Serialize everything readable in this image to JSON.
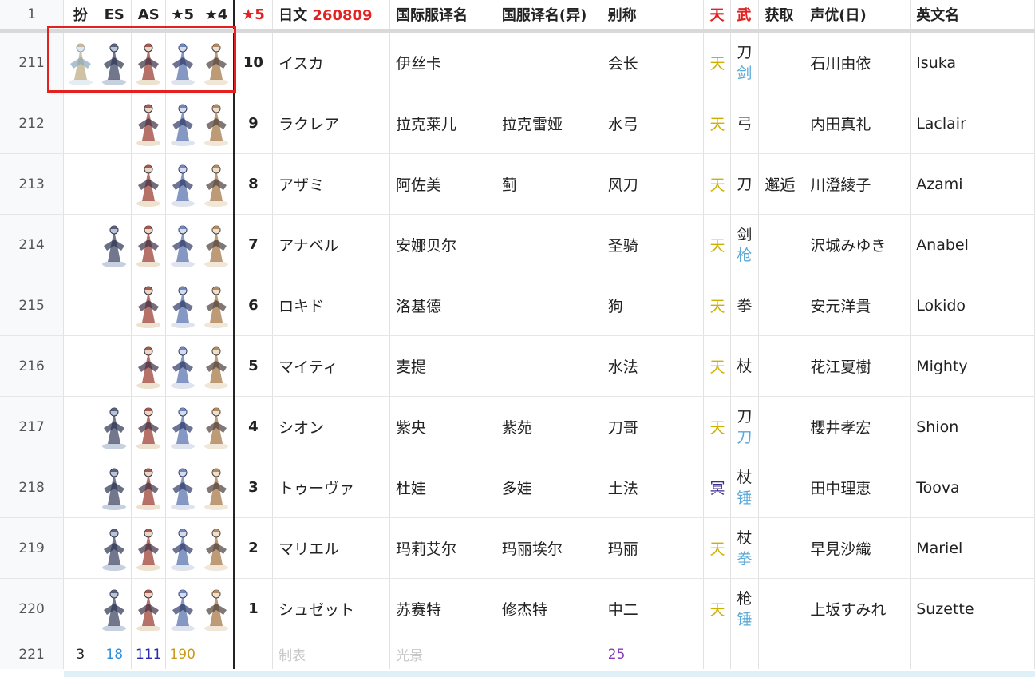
{
  "header": {
    "row_num": "1",
    "cols": [
      "扮",
      "ES",
      "AS",
      "★5",
      "★4",
      "★5",
      "日文",
      "260809",
      "国际服译名",
      "国服译名(异)",
      "别称",
      "天",
      "武",
      "获取",
      "声优(日)",
      "英文名"
    ]
  },
  "rows": [
    {
      "num": "211",
      "icons": [
        "costume",
        "es",
        "as",
        "s5",
        "s4"
      ],
      "rank": "10",
      "jp": "イスカ",
      "intl": "伊丝卡",
      "cn_alt": "",
      "alias": "会长",
      "tian": "天",
      "tian_type": "ten",
      "weapon": [
        "刀",
        "剑"
      ],
      "acquire": "",
      "cv": "石川由依",
      "en": "Isuka"
    },
    {
      "num": "212",
      "icons": [
        "",
        "",
        "as",
        "s5",
        "s4"
      ],
      "rank": "9",
      "jp": "ラクレア",
      "intl": "拉克莱儿",
      "cn_alt": "拉克雷娅",
      "alias": "水弓",
      "tian": "天",
      "tian_type": "ten",
      "weapon": [
        "弓"
      ],
      "acquire": "",
      "cv": "内田真礼",
      "en": "Laclair"
    },
    {
      "num": "213",
      "icons": [
        "",
        "",
        "as",
        "s5",
        "s4"
      ],
      "rank": "8",
      "jp": "アザミ",
      "intl": "阿佐美",
      "cn_alt": "蓟",
      "alias": "风刀",
      "tian": "天",
      "tian_type": "ten",
      "weapon": [
        "刀"
      ],
      "acquire": "邂逅",
      "cv": "川澄綾子",
      "en": "Azami"
    },
    {
      "num": "214",
      "icons": [
        "",
        "es",
        "as",
        "s5",
        "s4"
      ],
      "rank": "7",
      "jp": "アナベル",
      "intl": "安娜贝尔",
      "cn_alt": "",
      "alias": "圣骑",
      "tian": "天",
      "tian_type": "ten",
      "weapon": [
        "剑",
        "枪"
      ],
      "acquire": "",
      "cv": "沢城みゆき",
      "en": "Anabel"
    },
    {
      "num": "215",
      "icons": [
        "",
        "",
        "as",
        "s5",
        "s4"
      ],
      "rank": "6",
      "jp": "ロキド",
      "intl": "洛基德",
      "cn_alt": "",
      "alias": "狗",
      "tian": "天",
      "tian_type": "ten",
      "weapon": [
        "拳"
      ],
      "acquire": "",
      "cv": "安元洋貴",
      "en": "Lokido"
    },
    {
      "num": "216",
      "icons": [
        "",
        "",
        "as",
        "s5",
        "s4"
      ],
      "rank": "5",
      "jp": "マイティ",
      "intl": "麦提",
      "cn_alt": "",
      "alias": "水法",
      "tian": "天",
      "tian_type": "ten",
      "weapon": [
        "杖"
      ],
      "acquire": "",
      "cv": "花江夏樹",
      "en": "Mighty"
    },
    {
      "num": "217",
      "icons": [
        "",
        "es",
        "as",
        "s5",
        "s4"
      ],
      "rank": "4",
      "jp": "シオン",
      "intl": "紫央",
      "cn_alt": "紫苑",
      "alias": "刀哥",
      "tian": "天",
      "tian_type": "ten",
      "weapon": [
        "刀",
        "刀"
      ],
      "acquire": "",
      "cv": "櫻井孝宏",
      "en": "Shion"
    },
    {
      "num": "218",
      "icons": [
        "",
        "es",
        "as",
        "s5",
        "s4"
      ],
      "rank": "3",
      "jp": "トゥーヴァ",
      "intl": "杜娃",
      "cn_alt": "多娃",
      "alias": "土法",
      "tian": "冥",
      "tian_type": "ming",
      "weapon": [
        "杖",
        "锤"
      ],
      "acquire": "",
      "cv": "田中理恵",
      "en": "Toova"
    },
    {
      "num": "219",
      "icons": [
        "",
        "es",
        "as",
        "s5",
        "s4"
      ],
      "rank": "2",
      "jp": "マリエル",
      "intl": "玛莉艾尔",
      "cn_alt": "玛丽埃尔",
      "alias": "玛丽",
      "tian": "天",
      "tian_type": "ten",
      "weapon": [
        "杖",
        "拳"
      ],
      "acquire": "",
      "cv": "早見沙織",
      "en": "Mariel"
    },
    {
      "num": "220",
      "icons": [
        "",
        "es",
        "as",
        "s5",
        "s4"
      ],
      "rank": "1",
      "jp": "シュゼット",
      "intl": "苏赛特",
      "cn_alt": "修杰特",
      "alias": "中二",
      "tian": "天",
      "tian_type": "ten",
      "weapon": [
        "枪",
        "锤"
      ],
      "acquire": "",
      "cv": "上坂すみれ",
      "en": "Suzette"
    }
  ],
  "footer": {
    "num": "221",
    "costume": "3",
    "es": "18",
    "as": "111",
    "s5": "190",
    "made_by": "制表",
    "source": "光景",
    "alias_count": "25"
  },
  "colors": {
    "ten": "#cdb000",
    "ming": "#3d2b8f",
    "red": "#e32222",
    "link_blue": "#5aa9d6",
    "highlight": "#e5211f"
  }
}
